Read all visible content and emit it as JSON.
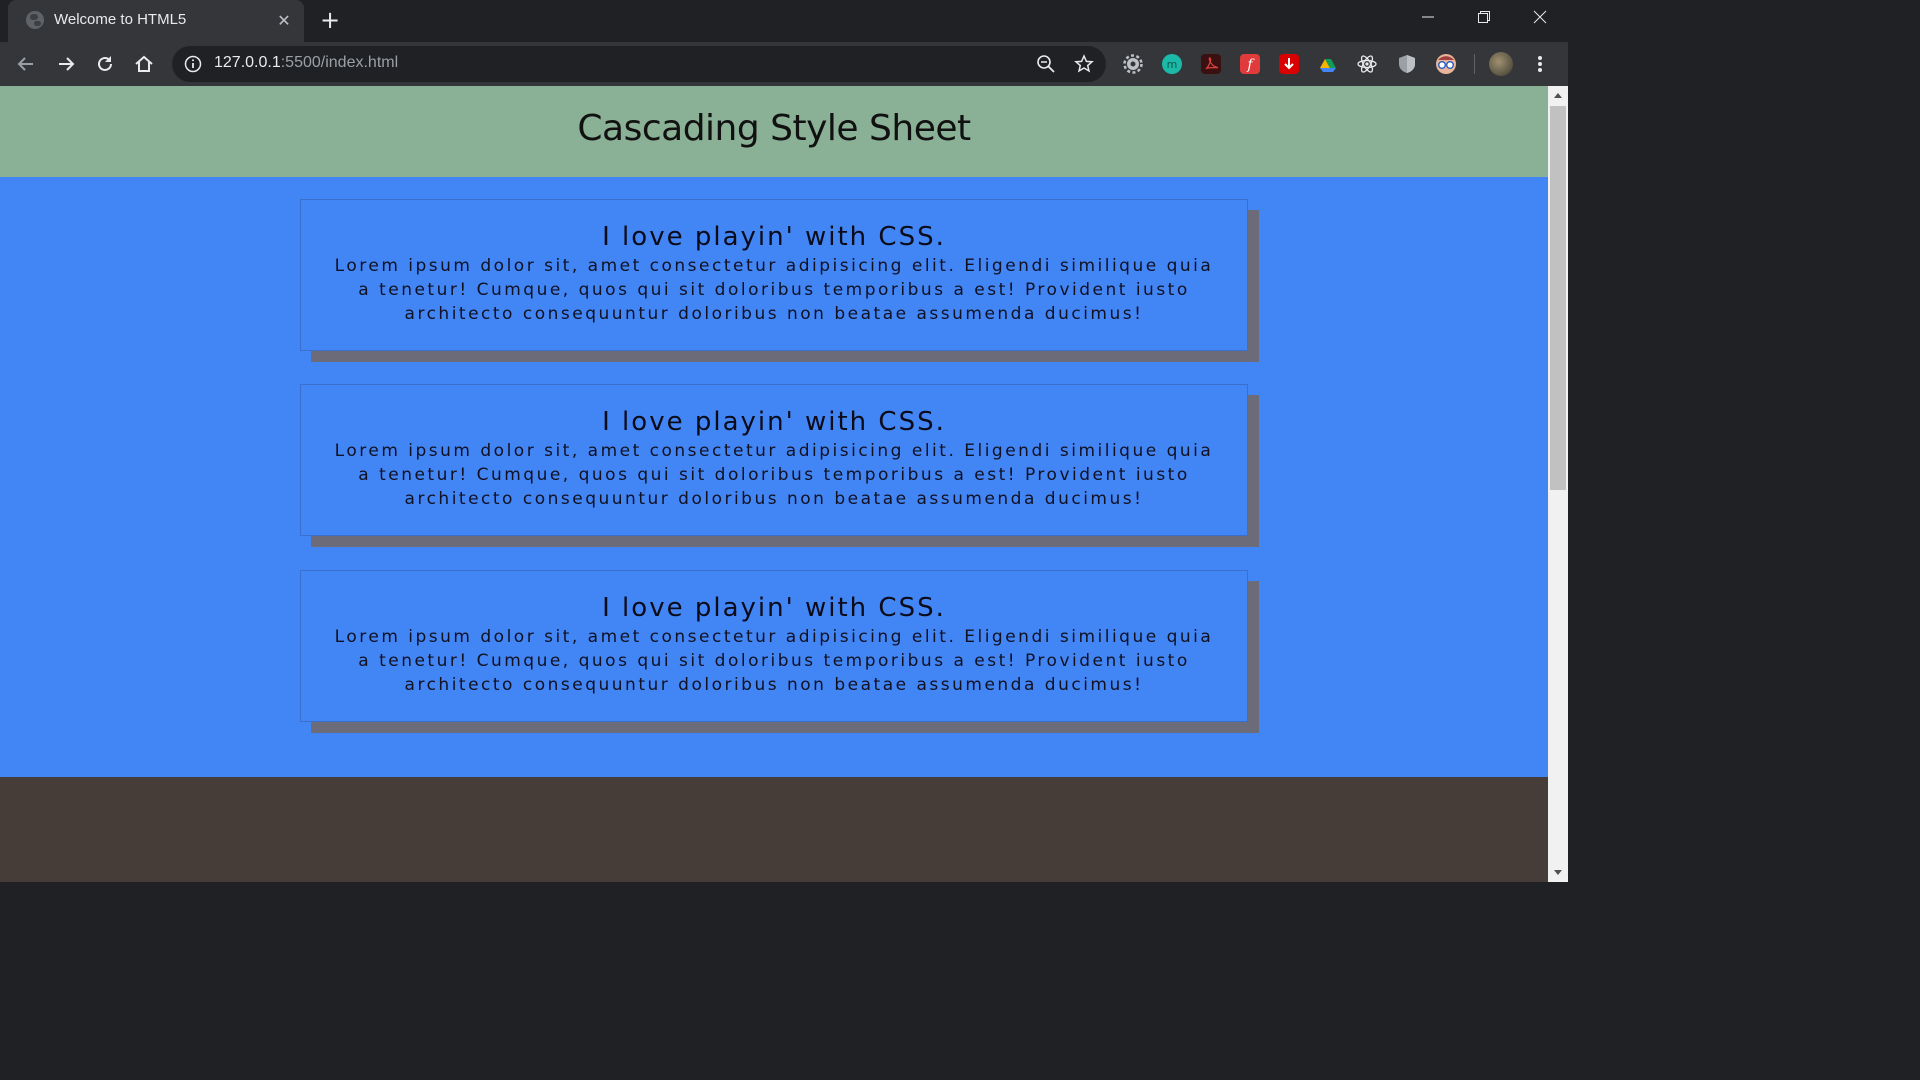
{
  "browser": {
    "tab_title": "Welcome to HTML5",
    "url_host": "127.0.0.1",
    "url_rest": ":5500/index.html",
    "extensions": [
      "gear-icon",
      "m-icon",
      "pdf-icon",
      "f-icon",
      "download-icon",
      "drive-icon",
      "react-icon",
      "shield-icon",
      "glasses-icon"
    ]
  },
  "page": {
    "heading": "Cascading Style Sheet",
    "cards": [
      {
        "title": "I love playin' with CSS.",
        "body": "Lorem ipsum dolor sit, amet consectetur adipisicing elit. Eligendi similique quia a tenetur! Cumque, quos qui sit doloribus temporibus a est! Provident iusto architecto consequuntur doloribus non beatae assumenda ducimus!"
      },
      {
        "title": "I love playin' with CSS.",
        "body": "Lorem ipsum dolor sit, amet consectetur adipisicing elit. Eligendi similique quia a tenetur! Cumque, quos qui sit doloribus temporibus a est! Provident iusto architecto consequuntur doloribus non beatae assumenda ducimus!"
      },
      {
        "title": "I love playin' with CSS.",
        "body": "Lorem ipsum dolor sit, amet consectetur adipisicing elit. Eligendi similique quia a tenetur! Cumque, quos qui sit doloribus temporibus a est! Provident iusto architecto consequuntur doloribus non beatae assumenda ducimus!"
      }
    ]
  },
  "colors": {
    "header_bg": "#8ab196",
    "main_bg": "#4285f4",
    "footer_bg": "#473d38",
    "card_shadow": "#6b6b7a"
  }
}
